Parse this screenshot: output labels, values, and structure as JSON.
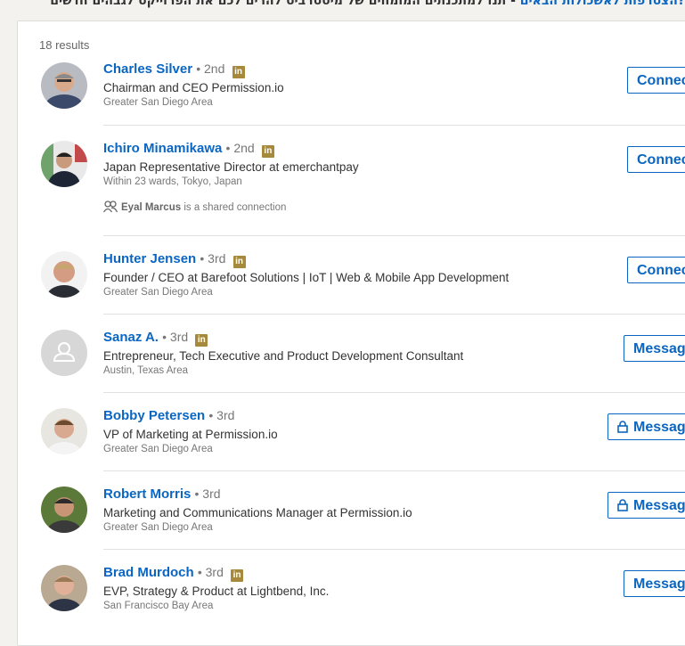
{
  "banner": {
    "link_text": "?הצטרפות לאשכולות הבאים",
    "text": " - תנו למתכנתים המומחים של מיסטרביט להרים לכם את הפרוייקט לגבהים חדשים"
  },
  "results": {
    "count_label": "18 results",
    "people": [
      {
        "name": "Charles Silver",
        "degree": "• 2nd",
        "li": "in",
        "headline": "Chairman and CEO Permission.io",
        "location": "Greater San Diego Area",
        "action": "Connect"
      },
      {
        "name": "Ichiro Minamikawa",
        "degree": "• 2nd",
        "li": "in",
        "headline": "Japan Representative Director at emerchantpay",
        "location": "Within 23 wards, Tokyo, Japan",
        "shared_name": "Eyal Marcus",
        "shared_suffix": " is a shared connection",
        "action": "Connect"
      },
      {
        "name": "Hunter Jensen",
        "degree": "• 3rd",
        "li": "in",
        "headline": "Founder / CEO at Barefoot Solutions | IoT | Web & Mobile App Development",
        "location": "Greater San Diego Area",
        "action": "Connect"
      },
      {
        "name": "Sanaz A.",
        "degree": "• 3rd",
        "li": "in",
        "headline": "Entrepreneur, Tech Executive and Product Development Consultant",
        "location": "Austin, Texas Area",
        "action": "Message"
      },
      {
        "name": "Bobby Petersen",
        "degree": "• 3rd",
        "headline": "VP of Marketing at Permission.io",
        "location": "Greater San Diego Area",
        "action": "Message"
      },
      {
        "name": "Robert Morris",
        "degree": "• 3rd",
        "headline": "Marketing and Communications Manager at Permission.io",
        "location": "Greater San Diego Area",
        "action": "Message"
      },
      {
        "name": "Brad Murdoch",
        "degree": "• 3rd",
        "li": "in",
        "headline": "EVP, Strategy & Product at Lightbend, Inc.",
        "location": "San Francisco Bay Area",
        "action": "Message"
      }
    ]
  },
  "colors": {
    "link": "#0a66c2",
    "premium_badge": "#a6893a",
    "text": "#333333",
    "muted": "#777777"
  },
  "icons": {
    "badge": "linkedin-badge-icon",
    "lock": "lock-icon",
    "shared": "shared-connection-icon",
    "placeholder": "default-avatar-icon"
  }
}
